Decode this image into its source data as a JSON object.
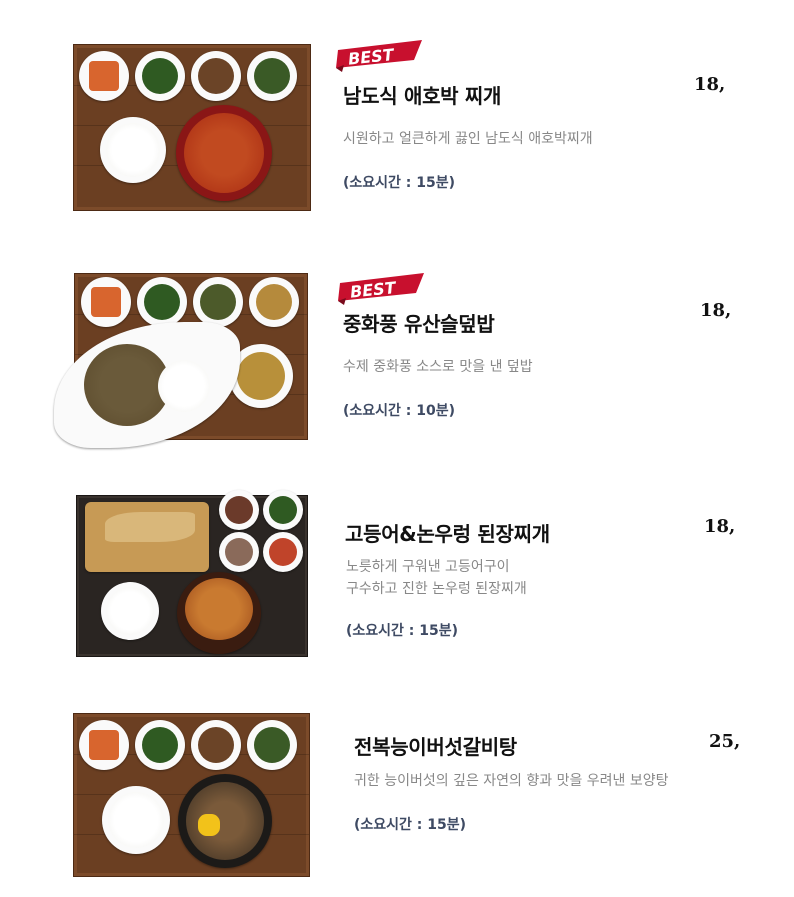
{
  "badge_text": "BEST",
  "items": [
    {
      "title": "남도식 애호박 찌개",
      "price": "18,",
      "desc_lines": [
        "시원하고 얼큰하게 끓인 남도식 애호박찌개"
      ],
      "time": "(소요시간 : 15분)",
      "best": true
    },
    {
      "title": "중화풍 유산슬덮밥",
      "price": "18,",
      "desc_lines": [
        "수제 중화풍 소스로 맛을 낸 덮밥"
      ],
      "time": "(소요시간 : 10분)",
      "best": true
    },
    {
      "title": "고등어&논우렁 된장찌개",
      "price": "18,",
      "desc_lines": [
        "노릇하게 구워낸 고등어구이",
        "구수하고 진한 논우렁 된장찌개"
      ],
      "time": "(소요시간 : 15분)",
      "best": false
    },
    {
      "title": "전복능이버섯갈비탕",
      "price": "25,",
      "desc_lines": [
        "귀한 능이버섯의 깊은 자연의 향과 맛을 우려낸 보양탕"
      ],
      "time": "(소요시간 : 15분)",
      "best": false
    }
  ]
}
